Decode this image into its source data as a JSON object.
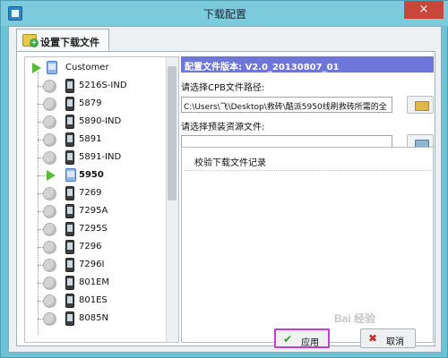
{
  "window": {
    "title": "下载配置",
    "close_symbol": "×"
  },
  "tab": {
    "label": "设置下载文件"
  },
  "tree": {
    "root": "Customer",
    "items": [
      {
        "label": "5216S-IND",
        "selected": false
      },
      {
        "label": "5879",
        "selected": false
      },
      {
        "label": "5890-IND",
        "selected": false
      },
      {
        "label": "5891",
        "selected": false
      },
      {
        "label": "5891-IND",
        "selected": false
      },
      {
        "label": "5950",
        "selected": true
      },
      {
        "label": "7269",
        "selected": false
      },
      {
        "label": "7295A",
        "selected": false
      },
      {
        "label": "7295S",
        "selected": false
      },
      {
        "label": "7296",
        "selected": false
      },
      {
        "label": "7296I",
        "selected": false
      },
      {
        "label": "801EM",
        "selected": false
      },
      {
        "label": "801ES",
        "selected": false
      },
      {
        "label": "8085N",
        "selected": false
      }
    ]
  },
  "config": {
    "version_text": "配置文件版本: V2.0_20130807_01",
    "cpb_label": "请选择CPB文件路径:",
    "cpb_value": "C:\\Users\\飞\\Desktop\\救砖\\酷派5950线刷救砖所需的全",
    "preload_label": "请选择预装资源文件:",
    "preload_value": "",
    "log_header": "校验下载文件记录"
  },
  "buttons": {
    "apply": "应用",
    "cancel": "取消"
  },
  "watermark": "Bai 经验",
  "colors": {
    "titlebar": "#7ccbdd",
    "version_bar": "#6f76d9",
    "apply_border": "#c43fd0",
    "close": "#c7473c"
  }
}
